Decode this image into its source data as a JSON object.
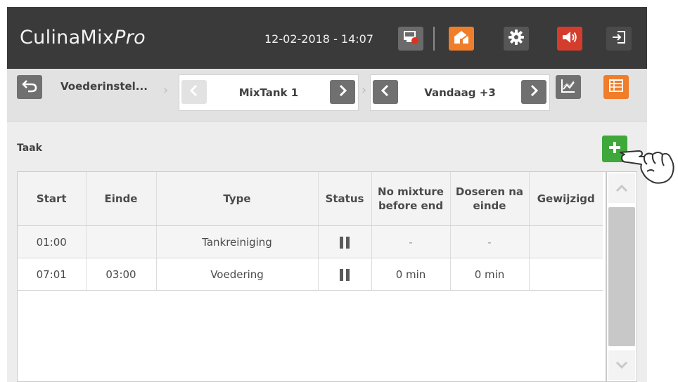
{
  "header": {
    "brand_main": "CulinaMix",
    "brand_suffix": "Pro",
    "datetime": "12-02-2018 - 14:07"
  },
  "nav": {
    "breadcrumb_label": "Voederinstel...",
    "tank_label": "MixTank 1",
    "day_label": "Vandaag +3"
  },
  "content": {
    "section_title": "Taak",
    "columns": [
      {
        "line1": "Start",
        "line2": ""
      },
      {
        "line1": "Einde",
        "line2": ""
      },
      {
        "line1": "Type",
        "line2": ""
      },
      {
        "line1": "Status",
        "line2": ""
      },
      {
        "line1": "No mixture",
        "line2": "before end"
      },
      {
        "line1": "Doseren na",
        "line2": "einde"
      },
      {
        "line1": "Gewijzigd",
        "line2": ""
      }
    ],
    "rows": [
      {
        "start": "01:00",
        "end": "",
        "type": "Tankreiniging",
        "status": "paused",
        "no_mixture": "-",
        "dosing_after": "-",
        "modified": ""
      },
      {
        "start": "07:01",
        "end": "03:00",
        "type": "Voedering",
        "status": "paused",
        "no_mixture": "0 min",
        "dosing_after": "0 min",
        "modified": ""
      }
    ]
  },
  "icons": {
    "toolbar": [
      "screen-alert-icon",
      "house-icon",
      "gear-icon",
      "speaker-icon",
      "logout-icon"
    ],
    "nav": [
      "back-arrow-icon",
      "chevron-left-icon",
      "chevron-right-icon",
      "chart-icon",
      "table-icon"
    ],
    "content": [
      "plus-icon",
      "pause-icon",
      "chevron-up-icon",
      "chevron-down-icon"
    ]
  },
  "colors": {
    "topbar": "#3a3a3a",
    "orange": "#f07d2a",
    "red": "#d43c2c",
    "green": "#3ea83b",
    "grey_button": "#707070"
  }
}
